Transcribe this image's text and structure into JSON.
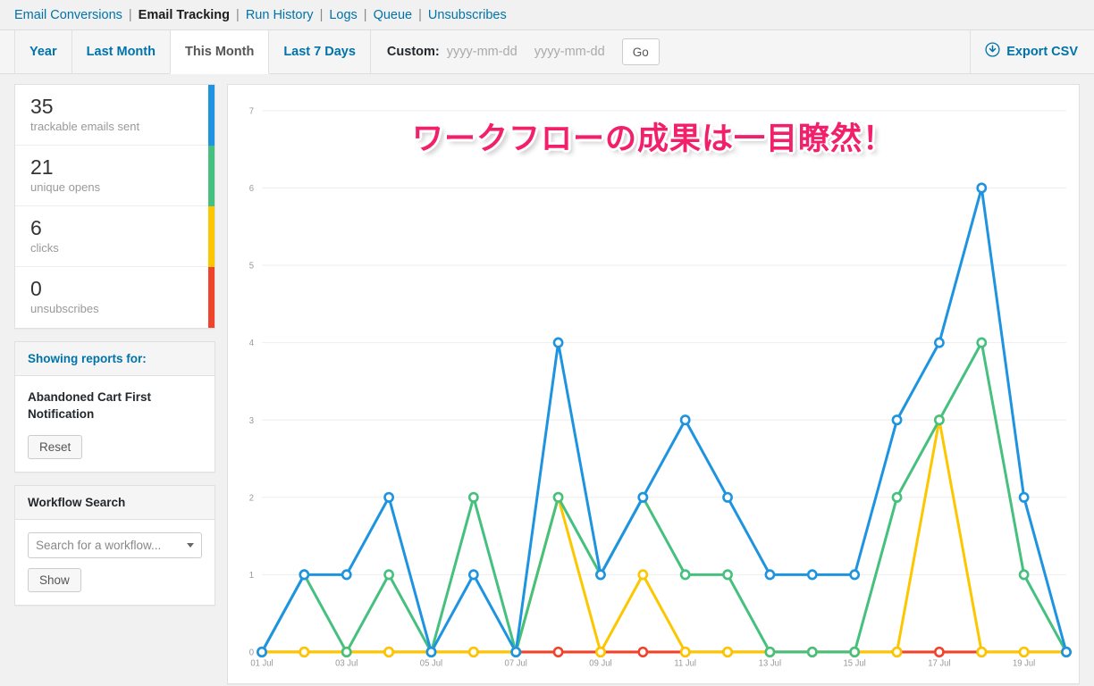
{
  "top_nav": {
    "items": [
      {
        "label": "Email Conversions",
        "current": false
      },
      {
        "label": "Email Tracking",
        "current": true
      },
      {
        "label": "Run History",
        "current": false
      },
      {
        "label": "Logs",
        "current": false
      },
      {
        "label": "Queue",
        "current": false
      },
      {
        "label": "Unsubscribes",
        "current": false
      }
    ],
    "separator": "|"
  },
  "filter_bar": {
    "range_tabs": [
      {
        "label": "Year",
        "active": false
      },
      {
        "label": "Last Month",
        "active": false
      },
      {
        "label": "This Month",
        "active": true
      },
      {
        "label": "Last 7 Days",
        "active": false
      }
    ],
    "custom_label": "Custom:",
    "date_from": {
      "value": "",
      "placeholder": "yyyy-mm-dd"
    },
    "date_to": {
      "value": "",
      "placeholder": "yyyy-mm-dd"
    },
    "go_label": "Go",
    "export_label": "Export CSV",
    "export_icon": "download-circle-icon"
  },
  "sidebar": {
    "stats": [
      {
        "value": "35",
        "label": "trackable emails sent",
        "color": "#1e94e0"
      },
      {
        "value": "21",
        "label": "unique opens",
        "color": "#45c07e"
      },
      {
        "value": "6",
        "label": "clicks",
        "color": "#fdc700"
      },
      {
        "value": "0",
        "label": "unsubscribes",
        "color": "#f0432c"
      }
    ],
    "reports_panel": {
      "header": "Showing reports for:",
      "workflow_name": "Abandoned Cart First Notification",
      "reset_label": "Reset"
    },
    "search_panel": {
      "header": "Workflow Search",
      "select_value": "Search for a workflow...",
      "show_label": "Show"
    }
  },
  "chart_overlay_text": "ワークフローの成果は一目瞭然！",
  "chart_data": {
    "type": "line",
    "title": "",
    "xlabel": "",
    "ylabel": "",
    "ylim": [
      0,
      7
    ],
    "yticks": [
      0,
      1,
      2,
      3,
      4,
      5,
      6,
      7
    ],
    "grid": true,
    "legend": "none",
    "x": [
      "01 Jul",
      "02 Jul",
      "03 Jul",
      "04 Jul",
      "05 Jul",
      "06 Jul",
      "07 Jul",
      "08 Jul",
      "09 Jul",
      "10 Jul",
      "11 Jul",
      "12 Jul",
      "13 Jul",
      "14 Jul",
      "15 Jul",
      "16 Jul",
      "17 Jul",
      "18 Jul",
      "19 Jul",
      "20 Jul"
    ],
    "xtick_labels": [
      "01 Jul",
      "",
      "03 Jul",
      "",
      "05 Jul",
      "",
      "07 Jul",
      "",
      "09 Jul",
      "",
      "11 Jul",
      "",
      "13 Jul",
      "",
      "15 Jul",
      "",
      "17 Jul",
      "",
      "19 Jul",
      ""
    ],
    "series": [
      {
        "name": "trackable emails sent",
        "color": "#1e94e0",
        "values": [
          0,
          1,
          1,
          2,
          0,
          1,
          0,
          4,
          1,
          2,
          3,
          2,
          1,
          1,
          1,
          3,
          4,
          6,
          2,
          0
        ]
      },
      {
        "name": "unique opens",
        "color": "#45c07e",
        "values": [
          0,
          1,
          0,
          1,
          0,
          2,
          0,
          2,
          1,
          2,
          1,
          1,
          0,
          0,
          0,
          2,
          3,
          4,
          1,
          0
        ]
      },
      {
        "name": "clicks",
        "color": "#fdc700",
        "values": [
          0,
          0,
          0,
          0,
          0,
          0,
          0,
          2,
          0,
          1,
          0,
          0,
          0,
          0,
          0,
          0,
          3,
          0,
          0,
          0
        ]
      },
      {
        "name": "unsubscribes",
        "color": "#f0432c",
        "values": [
          0,
          0,
          0,
          0,
          0,
          0,
          0,
          0,
          0,
          0,
          0,
          0,
          0,
          0,
          0,
          0,
          0,
          0,
          0,
          0
        ]
      }
    ]
  }
}
